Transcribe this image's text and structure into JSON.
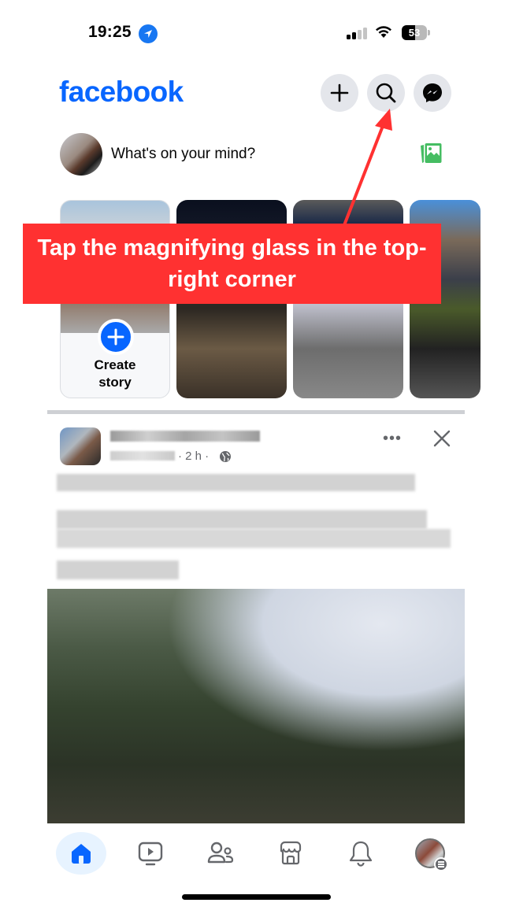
{
  "status_bar": {
    "time": "19:25",
    "location_icon": "location-arrow-icon",
    "signal_icon": "cellular-signal-icon",
    "wifi_icon": "wifi-icon",
    "battery_level": "53"
  },
  "header": {
    "logo": "facebook",
    "brand_color": "#0866ff",
    "buttons": [
      {
        "name": "create",
        "icon": "plus-icon"
      },
      {
        "name": "search",
        "icon": "search-icon"
      },
      {
        "name": "messenger",
        "icon": "messenger-icon"
      }
    ]
  },
  "composer": {
    "placeholder": "What's on your mind?",
    "photo_icon": "photo-gallery-icon",
    "photo_icon_color": "#45bd62"
  },
  "stories": {
    "create_label_line1": "Create",
    "create_label_line2": "story",
    "items": [
      {
        "type": "create"
      },
      {
        "type": "story"
      },
      {
        "type": "story"
      },
      {
        "type": "story"
      }
    ]
  },
  "post": {
    "author": "",
    "time": "· 2 h ·",
    "audience_icon": "globe-icon",
    "more_icon": "more-horizontal-icon",
    "close_icon": "close-icon"
  },
  "bottom_nav": {
    "items": [
      {
        "name": "home",
        "icon": "home-icon",
        "active": true
      },
      {
        "name": "video",
        "icon": "video-icon",
        "active": false
      },
      {
        "name": "friends",
        "icon": "friends-icon",
        "active": false
      },
      {
        "name": "marketplace",
        "icon": "marketplace-icon",
        "active": false
      },
      {
        "name": "notifications",
        "icon": "bell-icon",
        "active": false
      },
      {
        "name": "menu",
        "icon": "profile-menu-icon",
        "active": false
      }
    ]
  },
  "annotation": {
    "text": "Tap the magnifying glass in the top-right corner",
    "color": "#ff3131",
    "target": "search-button"
  }
}
